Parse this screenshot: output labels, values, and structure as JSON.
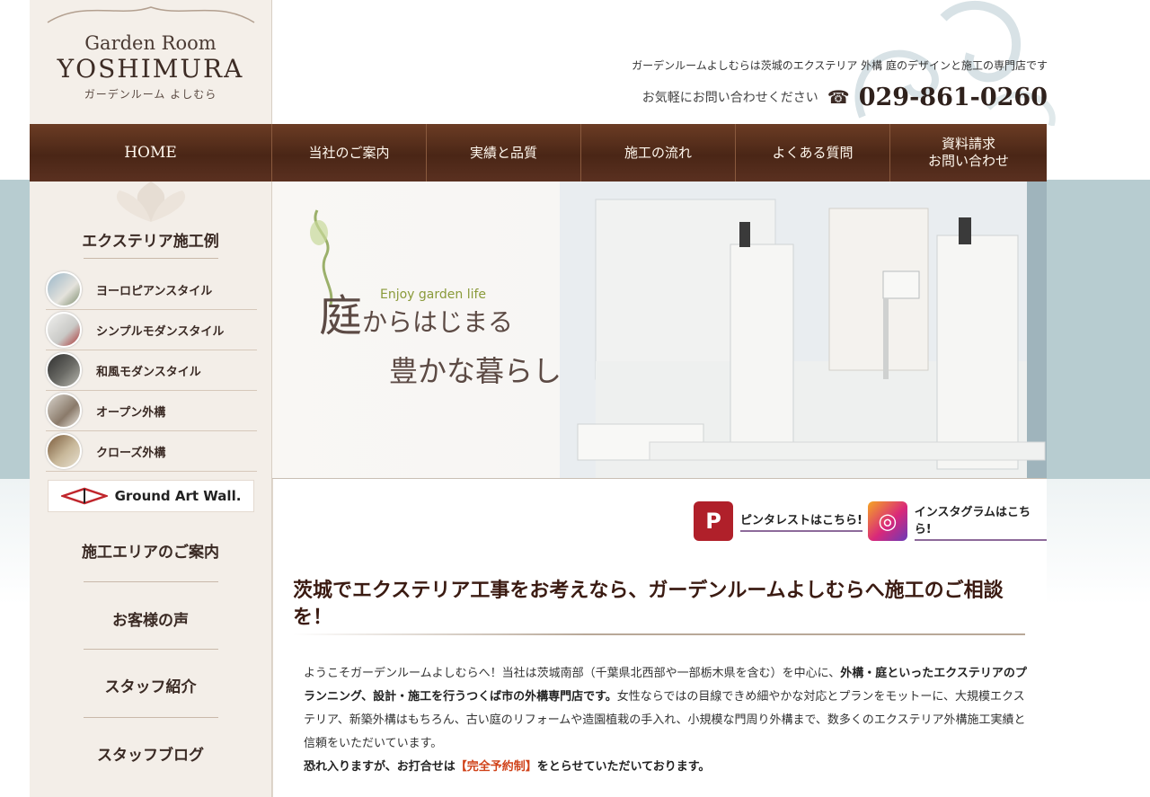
{
  "header": {
    "logo_line1": "Garden Room",
    "logo_line2": "YOSHIMURA",
    "logo_line3": "ガーデンルーム よしむら",
    "tagline": "ガーデンルームよしむらは茨城のエクステリア 外構 庭のデザインと施工の専門店です",
    "contact_note": "お気軽にお問い合わせください",
    "phone": "029-861-0260"
  },
  "nav": {
    "items": [
      {
        "label": "HOME"
      },
      {
        "label": "当社のご案内"
      },
      {
        "label": "実績と品質"
      },
      {
        "label": "施工の流れ"
      },
      {
        "label": "よくある質問"
      },
      {
        "label": "資料請求\nお問い合わせ"
      }
    ]
  },
  "sidebar": {
    "heading": "エクステリア施工例",
    "styles": [
      {
        "label": "ヨーロピアンスタイル"
      },
      {
        "label": "シンプルモダンスタイル"
      },
      {
        "label": "和風モダンスタイル"
      },
      {
        "label": "オープン外構"
      },
      {
        "label": "クローズ外構"
      }
    ],
    "banner_text": "Ground Art Wall.",
    "links": [
      {
        "label": "施工エリアのご案内"
      },
      {
        "label": "お客様の声"
      },
      {
        "label": "スタッフ紹介"
      },
      {
        "label": "スタッフブログ"
      }
    ]
  },
  "hero": {
    "en_text": "Enjoy garden life",
    "line1_big": "庭",
    "line1_rest": "からはじまる",
    "line2": "豊かな暮らし"
  },
  "social": {
    "pinterest_label": "ピンタレストはこちら!",
    "instagram_label": "インスタグラムはこちら!"
  },
  "content": {
    "headline": "茨城でエクステリア工事をお考えなら、ガーデンルームよしむらへ施工のご相談を！",
    "p1_a": "ようこそガーデンルームよしむらへ！当社は茨城南部（千葉県北西部や一部栃木県を含む）を中心に、",
    "p1_b": "外構・庭といったエクステリアのプランニング、設計・施工を行うつくば市の外構専門店です。",
    "p1_c": "女性ならではの目線できめ細やかな対応とプランをモットーに、大規模エクステリア、新築外構はもちろん、古い庭のリフォームや造園植栽の手入れ、小規模な門周り外構まで、数多くのエクステリア外構施工実績と信頼をいただいています。",
    "p2_a": "恐れ入りますが、お打合せは",
    "p2_red": "【完全予約制】",
    "p2_b": "をとらせていただいております。"
  }
}
